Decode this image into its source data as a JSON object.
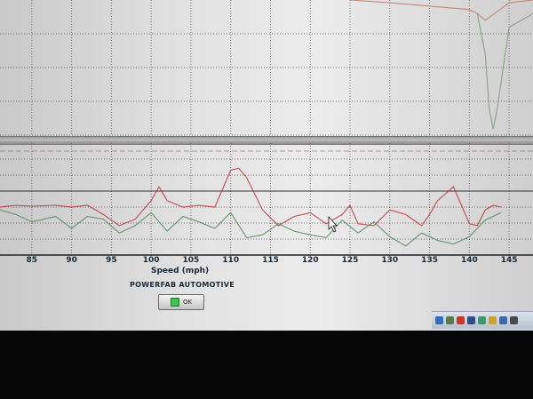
{
  "chart_data": {
    "type": "line",
    "xlabel": "Speed (mph)",
    "x_ticks": [
      "85",
      "90",
      "95",
      "100",
      "105",
      "110",
      "115",
      "120",
      "125",
      "130",
      "135",
      "140",
      "145"
    ],
    "xlim": [
      81,
      148
    ],
    "grid": true,
    "series": [
      {
        "color": "#c0303a",
        "x": [
          81,
          83,
          85,
          88,
          90,
          92,
          94,
          96,
          98,
          100,
          101,
          102,
          104,
          106,
          108,
          110,
          111,
          112,
          114,
          116,
          118,
          120,
          122,
          124,
          125,
          126,
          128,
          130,
          132,
          134,
          135,
          136,
          138,
          140,
          141,
          142,
          143,
          144
        ],
        "y": [
          0.52,
          0.5,
          0.51,
          0.5,
          0.52,
          0.5,
          0.6,
          0.72,
          0.65,
          0.45,
          0.3,
          0.45,
          0.52,
          0.5,
          0.52,
          0.12,
          0.1,
          0.2,
          0.55,
          0.72,
          0.62,
          0.58,
          0.7,
          0.6,
          0.5,
          0.7,
          0.72,
          0.55,
          0.6,
          0.72,
          0.6,
          0.45,
          0.3,
          0.7,
          0.72,
          0.55,
          0.5,
          0.52
        ]
      },
      {
        "color": "#4f8a5a",
        "x": [
          81,
          83,
          85,
          88,
          90,
          92,
          94,
          96,
          98,
          100,
          102,
          104,
          106,
          108,
          110,
          112,
          114,
          116,
          118,
          120,
          122,
          124,
          126,
          128,
          130,
          132,
          134,
          136,
          138,
          140,
          142,
          144
        ],
        "y": [
          0.55,
          0.6,
          0.68,
          0.62,
          0.75,
          0.62,
          0.65,
          0.8,
          0.72,
          0.58,
          0.78,
          0.62,
          0.68,
          0.75,
          0.58,
          0.85,
          0.82,
          0.7,
          0.78,
          0.82,
          0.85,
          0.66,
          0.8,
          0.68,
          0.84,
          0.94,
          0.8,
          0.88,
          0.92,
          0.84,
          0.66,
          0.58
        ]
      }
    ]
  },
  "upper_chart": {
    "series": [
      {
        "color": "#c07a5a",
        "x": [
          125,
          130,
          136,
          138,
          140,
          141,
          142,
          145,
          148
        ],
        "y": [
          0.0,
          0.02,
          0.05,
          0.06,
          0.07,
          0.1,
          0.15,
          0.02,
          0.0
        ]
      },
      {
        "color": "#7a9a7a",
        "x": [
          141,
          142,
          142.5,
          143,
          143.5,
          145,
          148
        ],
        "y": [
          0.1,
          0.4,
          0.8,
          0.95,
          0.8,
          0.2,
          0.1
        ]
      }
    ]
  },
  "axis": {
    "xlabel": "Speed (mph)",
    "ticks": [
      "85",
      "90",
      "95",
      "100",
      "105",
      "110",
      "115",
      "120",
      "125",
      "130",
      "135",
      "140",
      "145"
    ]
  },
  "footer": {
    "brand": "POWERFAB AUTOMOTIVE",
    "ok_label": "OK"
  },
  "tray": {
    "icons": [
      {
        "name": "network-icon",
        "color": "#2f6fbf"
      },
      {
        "name": "volume-icon",
        "color": "#5a7a4a"
      },
      {
        "name": "shield-icon",
        "color": "#c23b2b"
      },
      {
        "name": "monitor-icon",
        "color": "#2c4f8a"
      },
      {
        "name": "chat-icon",
        "color": "#3a9a6a"
      },
      {
        "name": "mail-icon",
        "color": "#d0a030"
      },
      {
        "name": "update-icon",
        "color": "#3a6ab0"
      },
      {
        "name": "battery-icon",
        "color": "#4a4a4a"
      }
    ]
  }
}
